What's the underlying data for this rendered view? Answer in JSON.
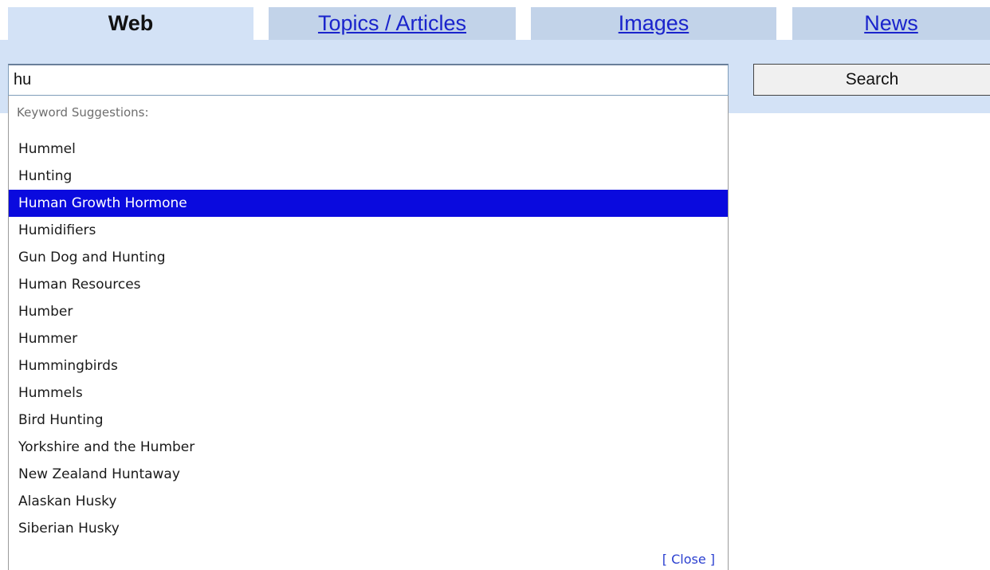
{
  "tabs": [
    {
      "label": "Web",
      "active": true
    },
    {
      "label": "Topics / Articles",
      "active": false
    },
    {
      "label": "Images",
      "active": false
    },
    {
      "label": "News",
      "active": false
    }
  ],
  "search": {
    "value": "hu",
    "button_label": "Search"
  },
  "suggestions": {
    "header": "Keyword Suggestions:",
    "selected_index": 2,
    "items": [
      "Hummel",
      "Hunting",
      "Human Growth Hormone",
      "Humidifiers",
      "Gun Dog and Hunting",
      "Human Resources",
      "Humber",
      "Hummer",
      "Hummingbirds",
      "Hummels",
      "Bird Hunting",
      "Yorkshire and the Humber",
      "New Zealand Huntaway",
      "Alaskan Husky",
      "Siberian Husky"
    ],
    "close_label": "[ Close ]"
  },
  "colors": {
    "tab_inactive": "#c2d3e9",
    "tab_active": "#d3e2f6",
    "link": "#1a24cc",
    "selection": "#0a0ade"
  }
}
